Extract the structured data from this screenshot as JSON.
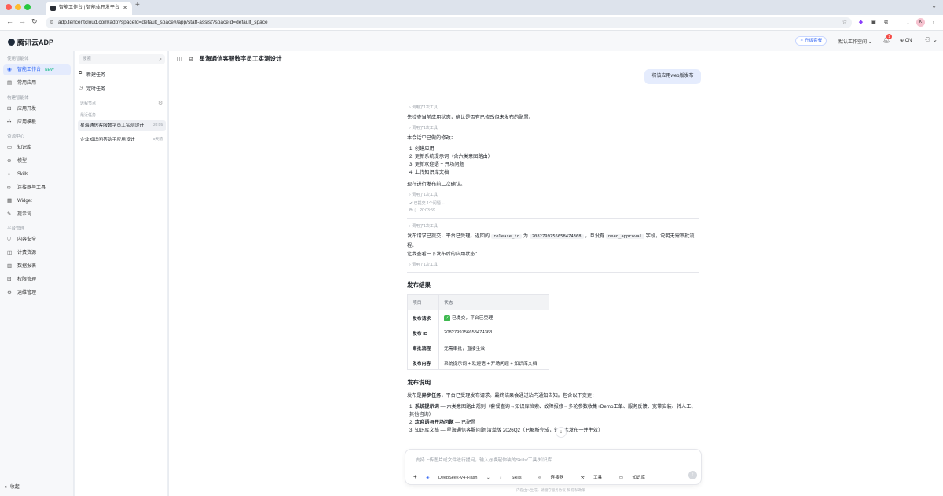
{
  "browser": {
    "tab_title": "智能工作台 | 智能体开发平台",
    "url": "adp.tencentcloud.com/adp?spaceId=default_space#/app/staff-assist?spaceId=default_space"
  },
  "header": {
    "logo": "腾讯云ADP",
    "upgrade": "升级套餐",
    "workspace": "默认工作空间",
    "notif_count": "1",
    "lang": "CN",
    "avatar": "K"
  },
  "sidebar": {
    "sec1": "使用智能体",
    "item_workbench": "智能工作台",
    "new_badge": "NEW",
    "item_common": "常用应用",
    "sec2": "构建智能体",
    "item_appdev": "应用开发",
    "item_template": "应用模板",
    "sec3": "资源中心",
    "item_kb": "知识库",
    "item_model": "模型",
    "item_skills": "Skills",
    "item_connector": "连接器与工具",
    "item_widget": "Widget",
    "item_prompt": "提示词",
    "sec4": "平台管理",
    "item_safety": "内容安全",
    "item_billing": "计费资源",
    "item_report": "数据报表",
    "item_perm": "权限管理",
    "item_ops": "运维管理",
    "collapse": "收起"
  },
  "panel": {
    "search_placeholder": "搜索",
    "new_task": "新建任务",
    "timed_task": "定时任务",
    "sec_remote": "远程节点",
    "sec_recent": "最近任务",
    "tasks": [
      {
        "title": "星海通信客服数字员工实测设计",
        "time": "20:05"
      },
      {
        "title": "企业知识问答助手应用设计",
        "time": "5天前"
      }
    ]
  },
  "main": {
    "title": "星海通信客服数字员工实测设计",
    "user_msg": "将该应用web版发布",
    "tool_call": "调用了1次工具",
    "p1": "先检查当前应用状态，确认是否有已修改但未发布的配置。",
    "p2": "本会话中已做的修改：",
    "changes": [
      "1. 创建应用",
      "2. 更新系统提示词（含六类意图路由）",
      "3. 更新欢迎语 + 开场问题",
      "4. 上传知识库文档"
    ],
    "p3": "现在进行发布前二次确认。",
    "confirmed": "已提交 1个问题",
    "time": "20:03:59",
    "p4a": "发布请求已提交，平台已受理。返回的",
    "code1": "release_id",
    "p4b": "为",
    "code2": "2082799756658474368",
    "p4c": "，且没有",
    "code3": "need_approval",
    "p4d": "字段，说明无需审批流程。",
    "p5": "让我查看一下发布后的应用状态：",
    "h1": "发布结果",
    "table": {
      "col1": "项目",
      "col2": "状态",
      "rows": [
        {
          "k": "发布请求",
          "v": "已提交，平台已受理"
        },
        {
          "k": "发布 ID",
          "v": "2082799756658474368"
        },
        {
          "k": "审批流程",
          "v": "无需审批，直接生效"
        },
        {
          "k": "发布内容",
          "v": "系统提示词 + 欢迎语 + 开场问题 + 知识库文档"
        }
      ]
    },
    "h2": "发布说明",
    "p6a": "发布是",
    "p6b": "异步任务",
    "p6c": "，平台已受理发布请求。最终结果会通过站内通知告知。包含以下变更：",
    "n1a": "1. ",
    "n1b": "系统提示词",
    "n1c": " — 六类意图路由规则（套餐查询→知识库检索、故障报修→多轮参数收集+Demo工单、服务反馈、宽带安装、转人工、其他咨询）",
    "n2a": "2. ",
    "n2b": "欢迎语与开场问题",
    "n2c": " — 已配置",
    "n3": "3. 知识库文档 — 星海通信客服问题 清单版 2026Q2（已解析完成，知识库发布一并生效）",
    "composer_placeholder": "支持上传图片或文件进行提问，输入@唤起你装的Skills/工具/知识库",
    "model": "DeepSeek-V4-Flash",
    "btn_skills": "Skills",
    "btn_connector": "连接器",
    "btn_tools": "工具",
    "btn_kb": "知识库",
    "footer": "内容由AI生成，请遵守服务协议 和 隐私政策"
  }
}
